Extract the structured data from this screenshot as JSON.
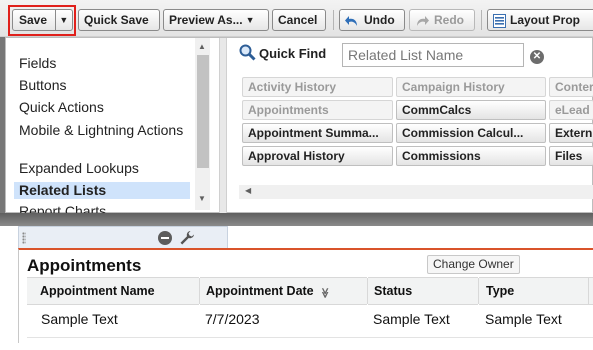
{
  "toolbar": {
    "save_label": "Save",
    "quick_save_label": "Quick Save",
    "preview_label": "Preview As...",
    "cancel_label": "Cancel",
    "undo_label": "Undo",
    "redo_label": "Redo",
    "layout_label": "Layout Prop"
  },
  "palette": {
    "categories": [
      {
        "label": "Fields"
      },
      {
        "label": "Buttons"
      },
      {
        "label": "Quick Actions"
      },
      {
        "label": "Mobile & Lightning Actions"
      },
      {
        "label": "Expanded Lookups"
      },
      {
        "label": "Related Lists",
        "selected": true
      },
      {
        "label": "Report Charts"
      }
    ],
    "quick_find_label": "Quick Find",
    "quick_find_placeholder": "Related List Name",
    "tiles": [
      [
        "Activity History",
        "Campaign History",
        "Conter"
      ],
      [
        "Appointments",
        "CommCalcs",
        "eLead"
      ],
      [
        "Appointment Summa...",
        "Commission Calcul...",
        "Extern"
      ],
      [
        "Approval History",
        "Commissions",
        "Files"
      ]
    ]
  },
  "related_list": {
    "title": "Appointments",
    "change_owner_label": "Change Owner",
    "columns": [
      "Appointment Name",
      "Appointment Date",
      "Status",
      "Type"
    ],
    "sort_indicator": "≫",
    "rows": [
      [
        "Sample Text",
        "7/7/2023",
        "Sample Text",
        "Sample Text"
      ]
    ]
  },
  "colors": {
    "highlight": "#e0201b",
    "selected_category": "#cfe3fb",
    "related_list_accent": "#d9532a"
  }
}
